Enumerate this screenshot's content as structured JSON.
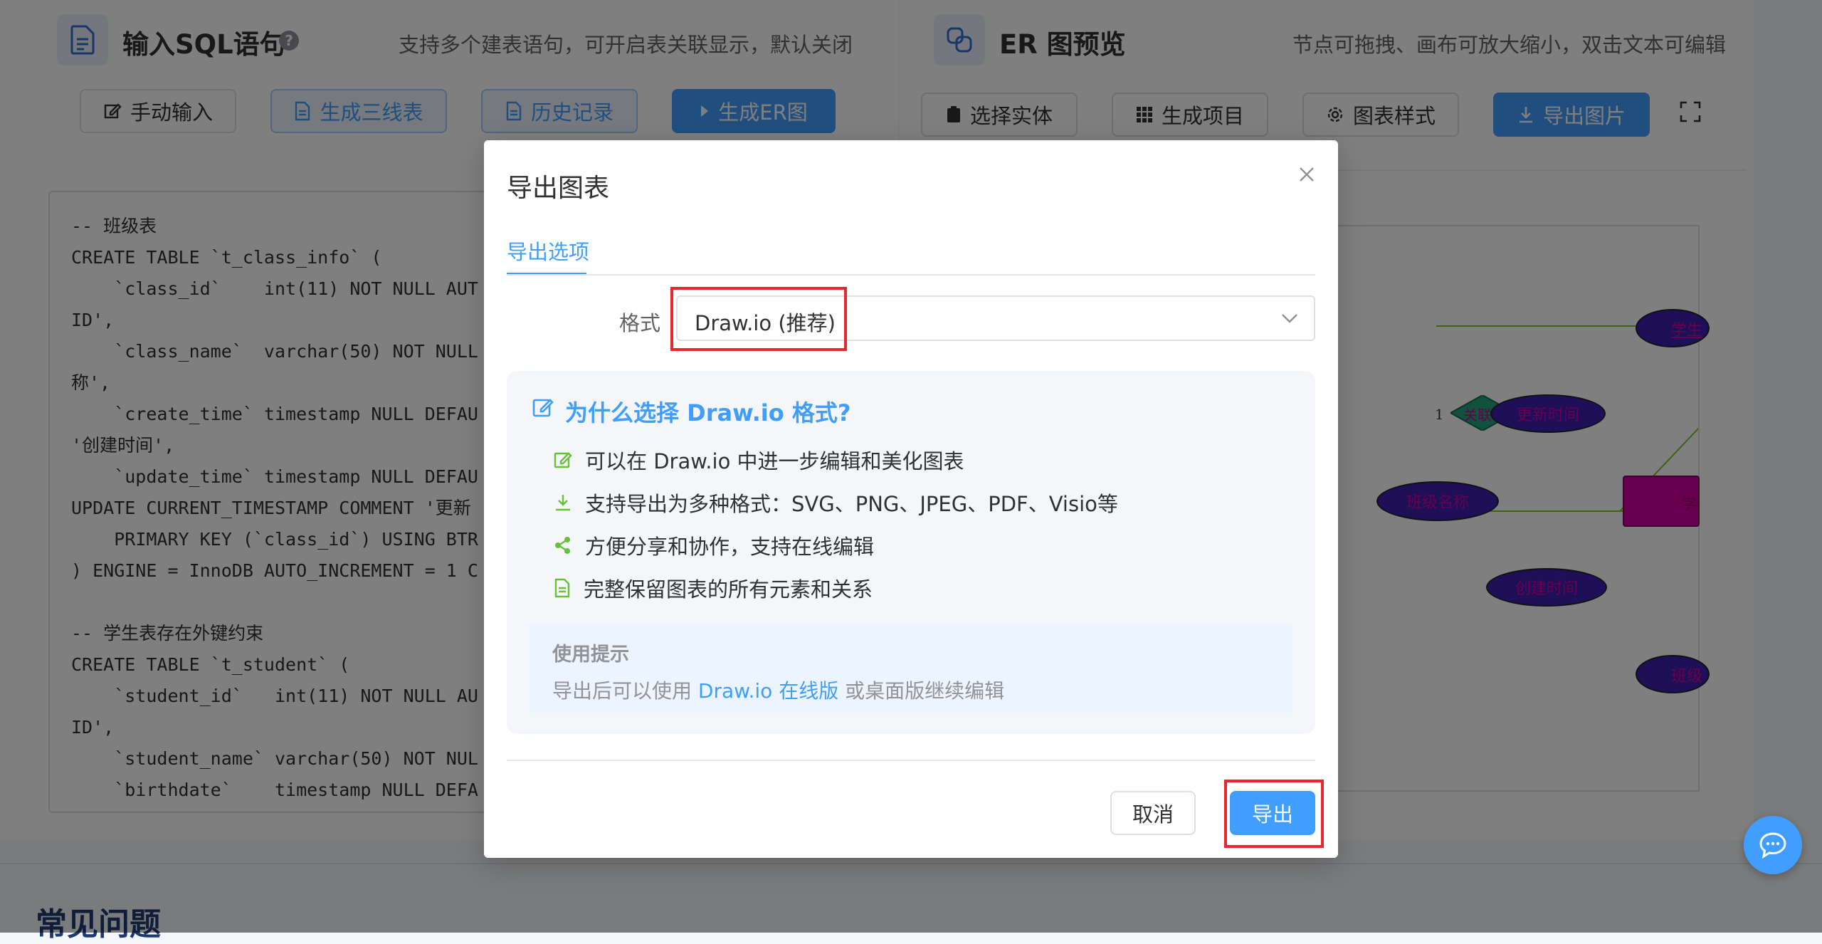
{
  "left_panel": {
    "title": "输入SQL语句",
    "hint": "支持多个建表语句，可开启表关联显示，默认关闭",
    "buttons": {
      "manual": "手动输入",
      "three_line": "生成三线表",
      "history": "历史记录",
      "generate_er": "生成ER图"
    },
    "code_lines": [
      "-- 班级表",
      "CREATE TABLE `t_class_info` (",
      "    `class_id`    int(11) NOT NULL AUT",
      "ID',",
      "    `class_name`  varchar(50) NOT NULL",
      "称',",
      "    `create_time` timestamp NULL DEFAU",
      "'创建时间',",
      "    `update_time` timestamp NULL DEFAU",
      "UPDATE CURRENT_TIMESTAMP COMMENT '更新",
      "    PRIMARY KEY (`class_id`) USING BTR",
      ") ENGINE = InnoDB AUTO_INCREMENT = 1 C",
      "",
      "-- 学生表存在外键约束",
      "CREATE TABLE `t_student` (",
      "    `student_id`   int(11) NOT NULL AU",
      "ID',",
      "    `student_name` varchar(50) NOT NUL",
      "    `birthdate`    timestamp NULL DEFA"
    ]
  },
  "right_panel": {
    "title": "ER 图预览",
    "hint": "节点可拖拽、画布可放大缩小，双击文本可编辑",
    "buttons": {
      "select_entity": "选择实体",
      "generate_project": "生成项目",
      "chart_style": "图表样式",
      "export_image": "导出图片"
    },
    "er_labels": {
      "student_top": "学生",
      "relation": "关联",
      "relation_card": "1",
      "update_time": "更新时间",
      "class_name": "班级名称",
      "create_time": "创建时间",
      "entity_partial": "学",
      "class_bottom": "班级"
    }
  },
  "faq_heading": "常见问题",
  "dialog": {
    "title": "导出图表",
    "tab": "导出选项",
    "format_label": "格式",
    "format_value": "Draw.io (推荐)",
    "info_title": "为什么选择 Draw.io 格式?",
    "features": [
      "可以在 Draw.io 中进一步编辑和美化图表",
      "支持导出为多种格式：SVG、PNG、JPEG、PDF、Visio等",
      "方便分享和协作，支持在线编辑",
      "完整保留图表的所有元素和关系"
    ],
    "tip_title": "使用提示",
    "tip_prefix": "导出后可以使用",
    "tip_link": "Draw.io 在线版",
    "tip_suffix": "或桌面版继续编辑",
    "cancel": "取消",
    "export": "导出"
  },
  "colors": {
    "primary": "#409eff",
    "highlight_border": "#e8262d",
    "er_entity": "#d3009f",
    "er_attribute": "#3b1eb0",
    "er_relation": "#22a37a",
    "er_line": "#7cc22b"
  }
}
